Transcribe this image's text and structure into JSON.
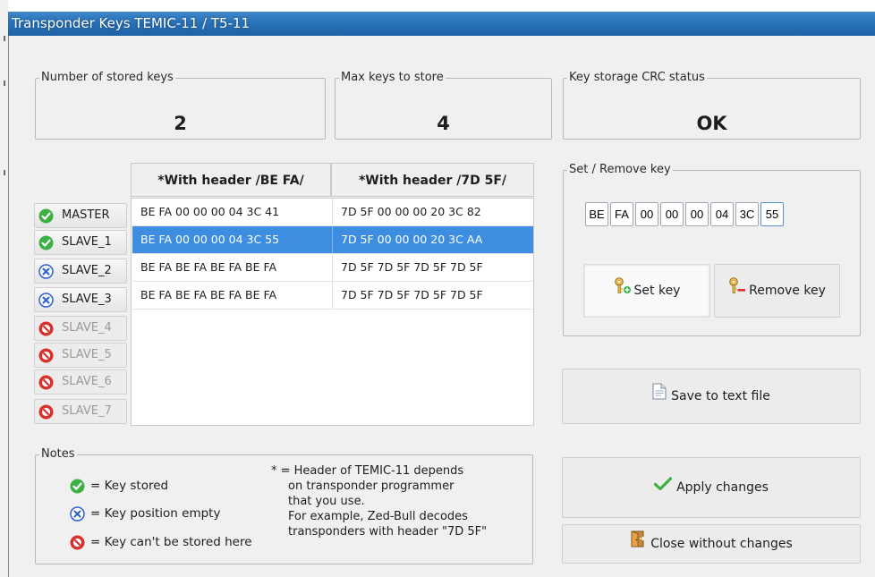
{
  "window": {
    "title": "Transponder Keys TEMIC-11 / T5-11"
  },
  "stats": {
    "stored": {
      "label": "Number of stored keys",
      "value": "2"
    },
    "max": {
      "label": "Max keys to store",
      "value": "4"
    },
    "crc": {
      "label": "Key storage CRC status",
      "value": "OK"
    }
  },
  "table": {
    "headers": [
      "*With header /BE FA/",
      "*With header /7D 5F/"
    ],
    "rows": [
      {
        "slot": "MASTER",
        "state": "stored",
        "a": "BE FA 00 00 00 04 3C 41",
        "b": "7D 5F 00 00 00 20 3C 82",
        "selected": false
      },
      {
        "slot": "SLAVE_1",
        "state": "stored",
        "a": "BE FA 00 00 00 04 3C 55",
        "b": "7D 5F 00 00 00 20 3C AA",
        "selected": true
      },
      {
        "slot": "SLAVE_2",
        "state": "empty",
        "a": "BE FA BE FA BE FA BE FA",
        "b": "7D 5F 7D 5F 7D 5F 7D 5F",
        "selected": false
      },
      {
        "slot": "SLAVE_3",
        "state": "empty",
        "a": "BE FA BE FA BE FA BE FA",
        "b": "7D 5F 7D 5F 7D 5F 7D 5F",
        "selected": false
      },
      {
        "slot": "SLAVE_4",
        "state": "disabled"
      },
      {
        "slot": "SLAVE_5",
        "state": "disabled"
      },
      {
        "slot": "SLAVE_6",
        "state": "disabled"
      },
      {
        "slot": "SLAVE_7",
        "state": "disabled"
      }
    ]
  },
  "setkey": {
    "label": "Set / Remove key",
    "bytes": [
      "BE",
      "FA",
      "00",
      "00",
      "00",
      "04",
      "3C",
      "55"
    ],
    "set_button": "Set key",
    "remove_button": "Remove key"
  },
  "actions": {
    "save": "Save to text file",
    "apply": "Apply changes",
    "close": "Close without changes"
  },
  "notes": {
    "label": "Notes",
    "stored": "= Key stored",
    "empty": "= Key position empty",
    "cant": "= Key can't be stored here",
    "footnote": [
      "* = Header of TEMIC-11 depends",
      "on transponder programmer",
      "that you use.",
      "For example, Zed-Bull decodes",
      "transponders with header \"7D 5F\""
    ]
  },
  "colors": {
    "title_bar": "#2870b8",
    "selection": "#3d8ee0",
    "ok_green": "#3cb043",
    "empty_blue": "#2d5fd0",
    "blocked_red": "#d9302c"
  },
  "icons": {
    "stored": "check-circle-icon",
    "empty": "x-circle-icon",
    "cant": "no-entry-icon",
    "set": "key-add-icon",
    "remove": "key-remove-icon",
    "save": "document-icon",
    "apply": "checkmark-icon",
    "close": "exit-door-icon"
  }
}
